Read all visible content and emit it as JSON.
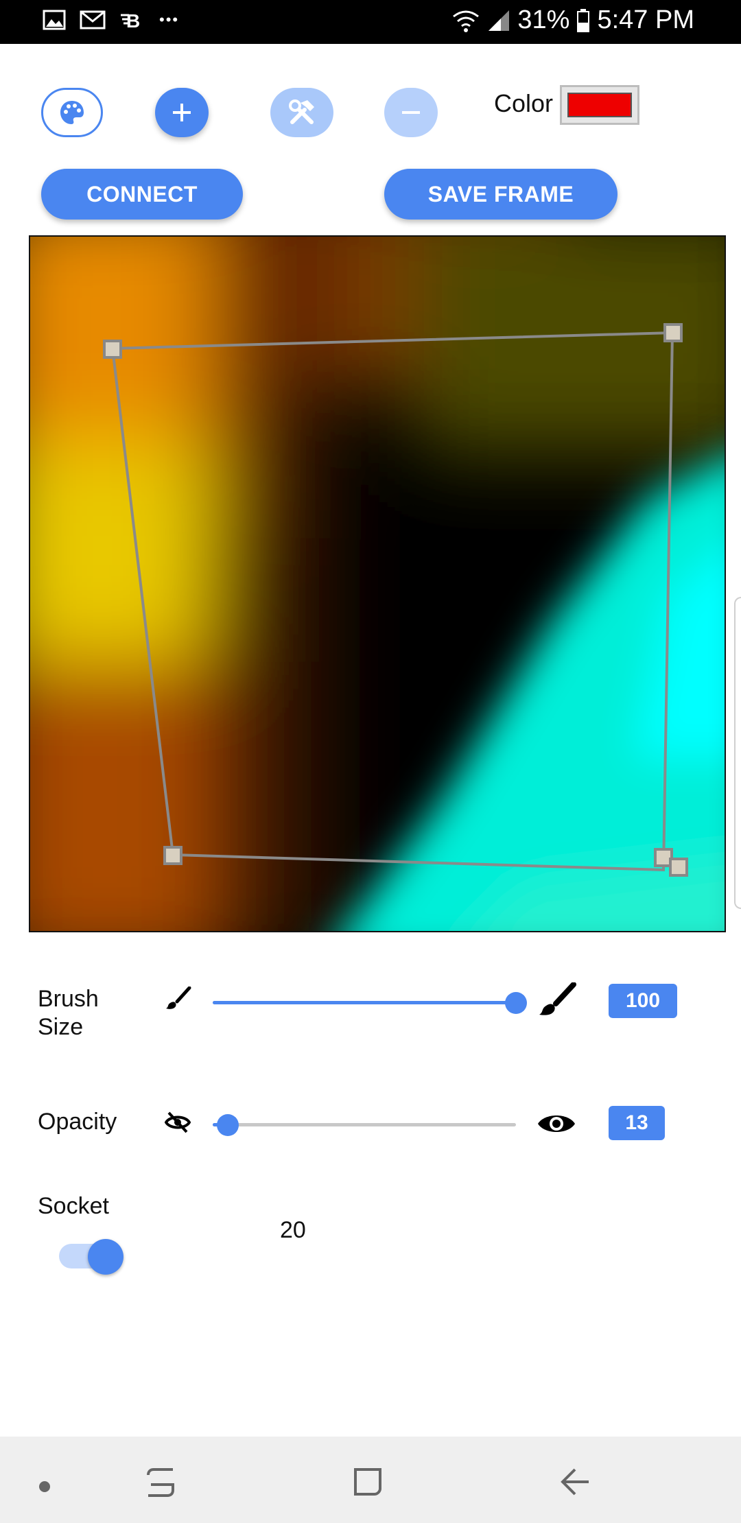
{
  "status_bar": {
    "battery": "31%",
    "time": "5:47 PM",
    "more": "•••"
  },
  "toolbar": {
    "color_label": "Color",
    "color_value": "#ee0000",
    "connect_label": "CONNECT",
    "save_frame_label": "SAVE FRAME"
  },
  "brush_size": {
    "label_line1": "Brush",
    "label_line2": "Size",
    "value": "100",
    "fraction": 1.0
  },
  "opacity": {
    "label": "Opacity",
    "value": "13",
    "fraction": 0.05
  },
  "socket": {
    "label": "Socket",
    "enabled": true,
    "value": "20"
  },
  "colors": {
    "accent": "#4a86f0",
    "accent_light": "#a9c8fa",
    "nav_bg": "#efefef"
  }
}
